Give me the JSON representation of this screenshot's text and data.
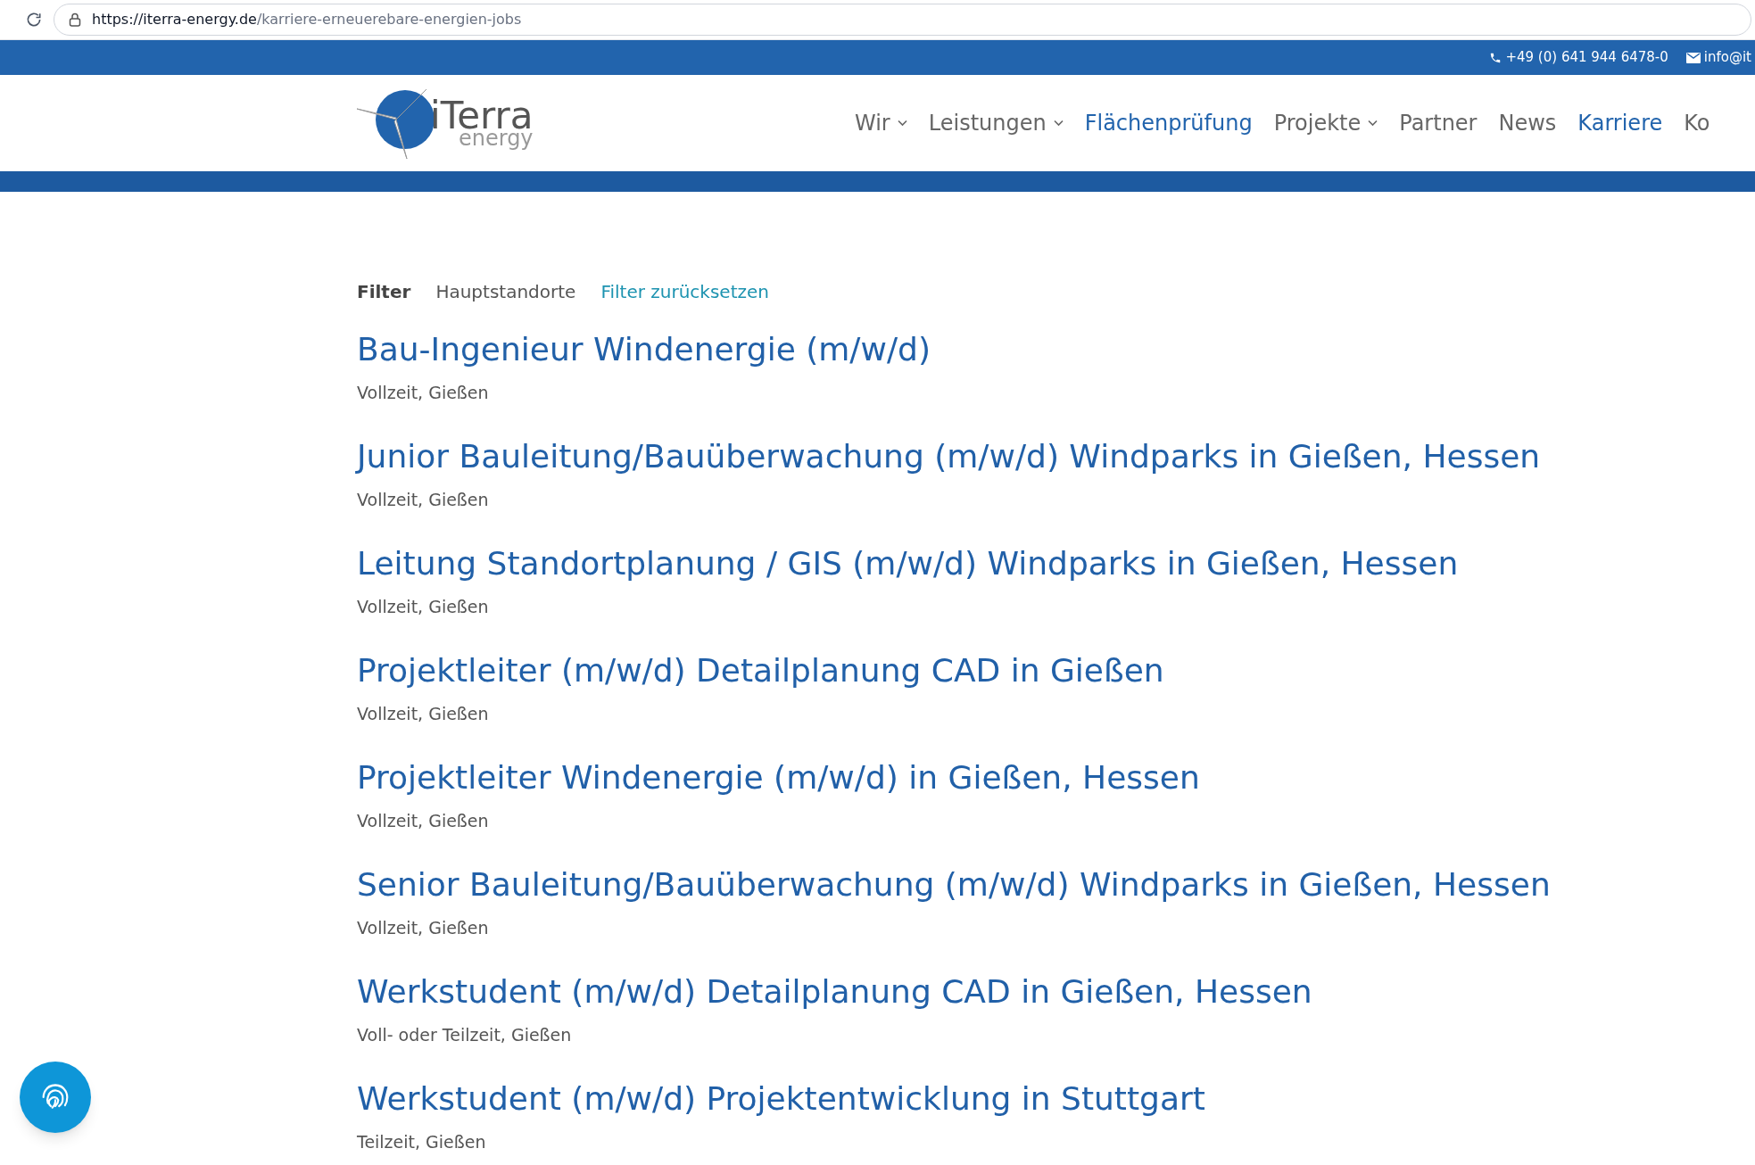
{
  "browser": {
    "url_host": "https://iterra-energy.de",
    "url_path": "/karriere-erneuerebare-energien-jobs"
  },
  "top_bar": {
    "phone": "+49 (0) 641 944 6478-0",
    "email": "info@it"
  },
  "logo": {
    "name": "iTerra",
    "sub": "energy"
  },
  "nav": [
    {
      "label": "Wir",
      "dropdown": true,
      "selected": false
    },
    {
      "label": "Leistungen",
      "dropdown": true,
      "selected": false
    },
    {
      "label": "Flächenprüfung",
      "dropdown": false,
      "selected": true
    },
    {
      "label": "Projekte",
      "dropdown": true,
      "selected": false
    },
    {
      "label": "Partner",
      "dropdown": false,
      "selected": false
    },
    {
      "label": "News",
      "dropdown": false,
      "selected": false
    },
    {
      "label": "Karriere",
      "dropdown": false,
      "selected": true
    },
    {
      "label": "Ko",
      "dropdown": false,
      "selected": false
    }
  ],
  "filter": {
    "label": "Filter",
    "option": "Hauptstandorte",
    "reset": "Filter zurücksetzen"
  },
  "jobs": [
    {
      "title": "Bau-Ingenieur Windenergie (m/w/d)",
      "meta": "Vollzeit, Gießen"
    },
    {
      "title": "Junior Bauleitung/Bauüberwachung (m/w/d) Windparks in Gießen, Hessen",
      "meta": "Vollzeit, Gießen"
    },
    {
      "title": "Leitung Standortplanung / GIS (m/w/d) Windparks in Gießen, Hessen",
      "meta": "Vollzeit, Gießen"
    },
    {
      "title": "Projektleiter (m/w/d) Detailplanung CAD in Gießen",
      "meta": "Vollzeit, Gießen"
    },
    {
      "title": "Projektleiter Windenergie (m/w/d) in Gießen, Hessen",
      "meta": "Vollzeit, Gießen"
    },
    {
      "title": "Senior Bauleitung/Bauüberwachung (m/w/d) Windparks in Gießen, Hessen",
      "meta": "Vollzeit, Gießen"
    },
    {
      "title": "Werkstudent (m/w/d) Detailplanung CAD in Gießen, Hessen",
      "meta": "Voll- oder Teilzeit, Gießen"
    },
    {
      "title": "Werkstudent (m/w/d) Projektentwicklung in Stuttgart",
      "meta": "Teilzeit, Gießen"
    }
  ]
}
